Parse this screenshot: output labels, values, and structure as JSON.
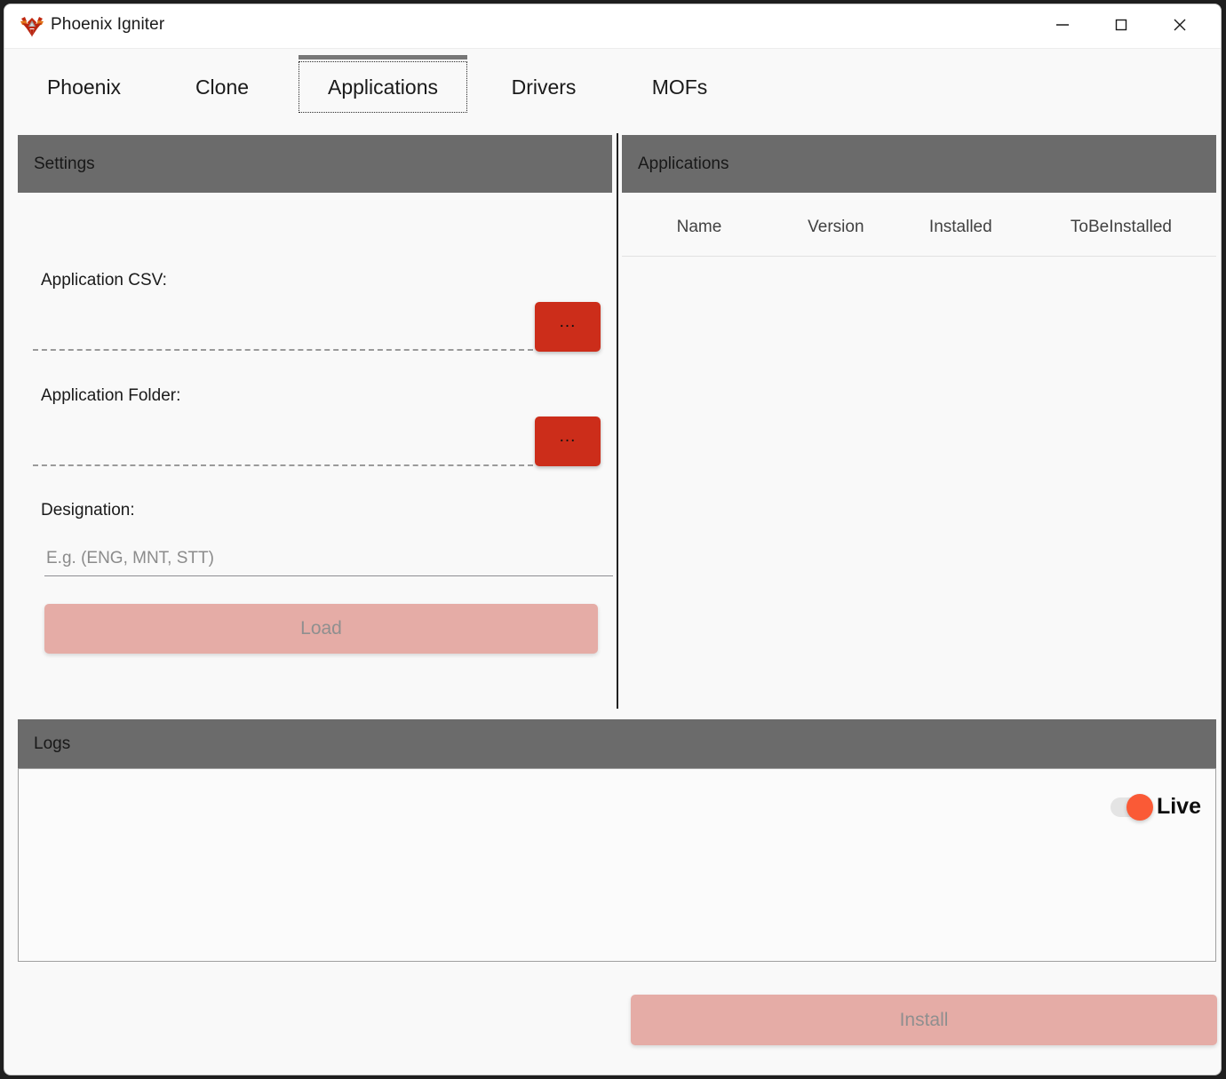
{
  "window": {
    "title": "Phoenix Igniter",
    "icon": "phoenix-logo-icon",
    "controls": {
      "minimize": "minimize-icon",
      "maximize": "maximize-icon",
      "close": "close-icon"
    }
  },
  "tabs": [
    {
      "label": "Phoenix",
      "selected": false
    },
    {
      "label": "Clone",
      "selected": false
    },
    {
      "label": "Applications",
      "selected": true
    },
    {
      "label": "Drivers",
      "selected": false
    },
    {
      "label": "MOFs",
      "selected": false
    }
  ],
  "settings": {
    "header": "Settings",
    "csv": {
      "label": "Application CSV:",
      "value": "",
      "placeholder": "",
      "browse_label": "..."
    },
    "folder": {
      "label": "Application Folder:",
      "value": "",
      "placeholder": "",
      "browse_label": "..."
    },
    "designation": {
      "label": "Designation:",
      "value": "",
      "placeholder": "E.g. (ENG, MNT, STT)"
    },
    "load_label": "Load"
  },
  "applications": {
    "header": "Applications",
    "columns": [
      "Name",
      "Version",
      "Installed",
      "ToBeInstalled"
    ],
    "rows": []
  },
  "logs": {
    "header": "Logs",
    "content": "",
    "live_label": "Live",
    "live_on": true
  },
  "footer": {
    "install_label": "Install"
  },
  "colors": {
    "accent_red": "#cc2d1a",
    "disabled_pink": "#e5aca6",
    "panel_header_grey": "#6b6b6b",
    "live_toggle": "#fa5a36"
  }
}
